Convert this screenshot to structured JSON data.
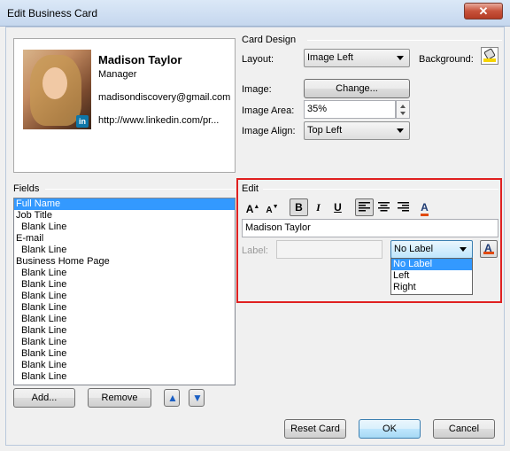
{
  "window": {
    "title": "Edit Business Card",
    "close_label": "✕"
  },
  "card": {
    "name": "Madison Taylor",
    "job_title": "Manager",
    "email": "madisondiscovery@gmail.com",
    "url": "http://www.linkedin.com/pr...",
    "linkedin_badge": "in"
  },
  "card_design": {
    "group_label": "Card Design",
    "layout_label": "Layout:",
    "layout_value": "Image Left",
    "background_label": "Background:",
    "image_label": "Image:",
    "change_button": "Change...",
    "image_area_label": "Image Area:",
    "image_area_value": "35%",
    "image_align_label": "Image Align:",
    "image_align_value": "Top Left"
  },
  "fields": {
    "group_label": "Fields",
    "items": [
      {
        "label": "Full Name",
        "indent": false,
        "selected": true
      },
      {
        "label": "Job Title",
        "indent": false,
        "selected": false
      },
      {
        "label": "Blank Line",
        "indent": true,
        "selected": false
      },
      {
        "label": "E-mail",
        "indent": false,
        "selected": false
      },
      {
        "label": "Blank Line",
        "indent": true,
        "selected": false
      },
      {
        "label": "Business Home Page",
        "indent": false,
        "selected": false
      },
      {
        "label": "Blank Line",
        "indent": true,
        "selected": false
      },
      {
        "label": "Blank Line",
        "indent": true,
        "selected": false
      },
      {
        "label": "Blank Line",
        "indent": true,
        "selected": false
      },
      {
        "label": "Blank Line",
        "indent": true,
        "selected": false
      },
      {
        "label": "Blank Line",
        "indent": true,
        "selected": false
      },
      {
        "label": "Blank Line",
        "indent": true,
        "selected": false
      },
      {
        "label": "Blank Line",
        "indent": true,
        "selected": false
      },
      {
        "label": "Blank Line",
        "indent": true,
        "selected": false
      },
      {
        "label": "Blank Line",
        "indent": true,
        "selected": false
      },
      {
        "label": "Blank Line",
        "indent": true,
        "selected": false
      }
    ],
    "add_button": "Add...",
    "remove_button": "Remove"
  },
  "edit": {
    "group_label": "Edit",
    "text_value": "Madison Taylor",
    "label_label": "Label:",
    "label_value": "",
    "label_position_value": "No Label",
    "label_position_options": [
      "No Label",
      "Left",
      "Right"
    ],
    "toolbar": {
      "grow_font": "A",
      "shrink_font": "A",
      "bold": "B",
      "italic": "I",
      "underline": "U",
      "font_color": "A"
    }
  },
  "footer": {
    "reset_button": "Reset Card",
    "ok_button": "OK",
    "cancel_button": "Cancel"
  },
  "colors": {
    "selection": "#3399ff",
    "highlight_frame": "#e02020",
    "font_color_bar": "#e04a10"
  },
  "icons": [
    "close-icon",
    "linkedin-icon",
    "background-fill-icon",
    "grow-font-icon",
    "shrink-font-icon",
    "bold-icon",
    "italic-icon",
    "underline-icon",
    "align-left-icon",
    "align-center-icon",
    "align-right-icon",
    "font-color-icon",
    "move-up-icon",
    "move-down-icon",
    "chevron-down-icon"
  ]
}
